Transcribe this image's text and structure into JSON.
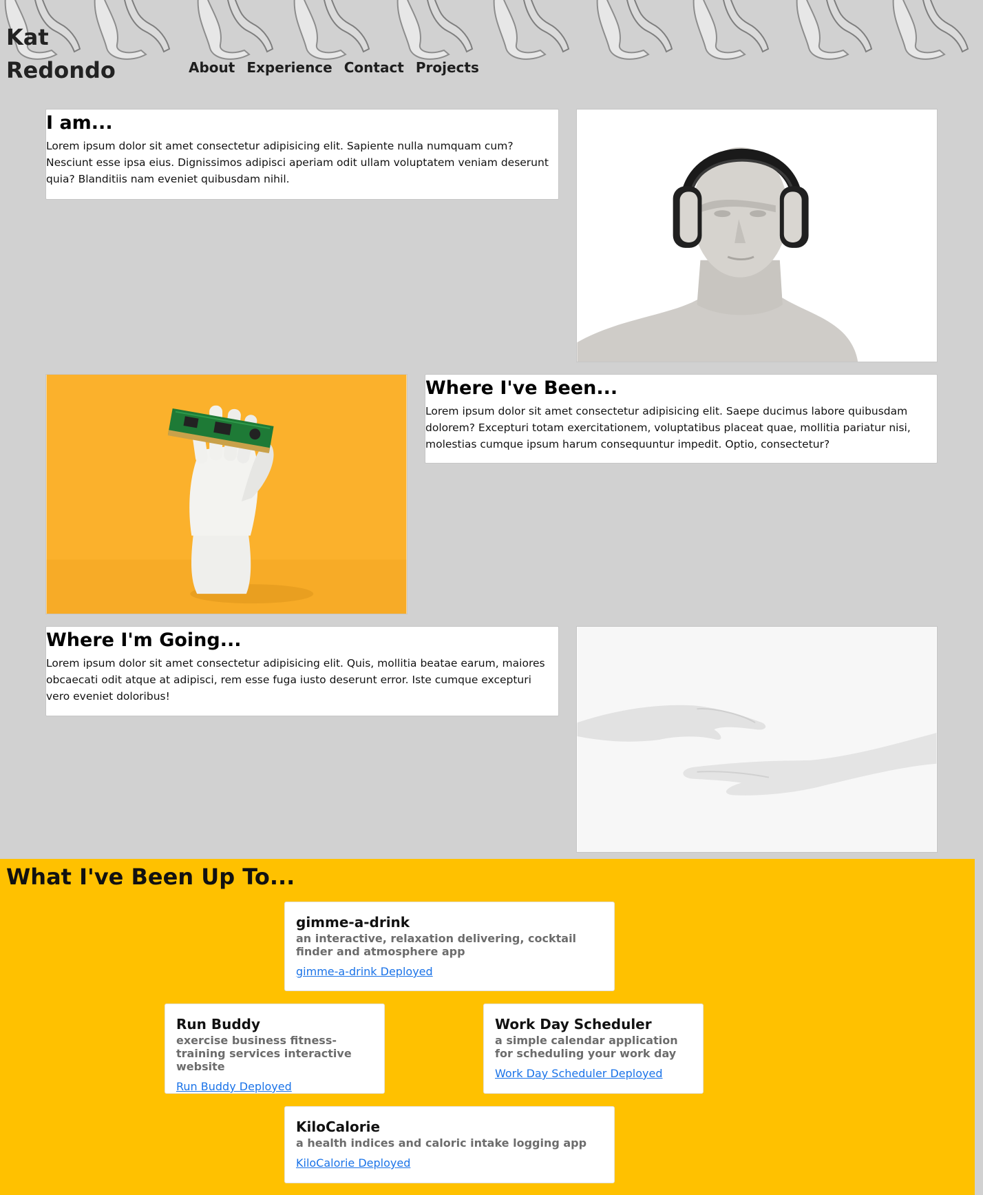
{
  "header": {
    "brand_line1": "Kat",
    "brand_line2": "Redondo",
    "nav": [
      "About",
      "Experience",
      "Contact",
      "Projects"
    ]
  },
  "sections": [
    {
      "title": "I am...",
      "body": "Lorem ipsum dolor sit amet consectetur adipisicing elit. Sapiente nulla numquam cum? Nesciunt esse ipsa eius. Dignissimos adipisci aperiam odit ullam voluptatem veniam deserunt quia? Blanditiis nam eveniet quibusdam nihil."
    },
    {
      "title": "Where I've Been...",
      "body": "Lorem ipsum dolor sit amet consectetur adipisicing elit. Saepe ducimus labore quibusdam dolorem? Excepturi totam exercitationem, voluptatibus placeat quae, mollitia pariatur nisi, molestias cumque ipsum harum consequuntur impedit. Optio, consectetur?"
    },
    {
      "title": "Where I'm Going...",
      "body": "Lorem ipsum dolor sit amet consectetur adipisicing elit. Quis, mollitia beatae earum, maiores obcaecati odit atque at adipisci, rem esse fuga iusto deserunt error. Iste cumque excepturi vero eveniet doloribus!"
    }
  ],
  "projects": {
    "title": "What I've Been Up To...",
    "items": [
      {
        "name": "gimme-a-drink",
        "description": "an interactive, relaxation delivering, cocktail finder and atmosphere app",
        "link": "gimme-a-drink Deployed"
      },
      {
        "name": "Run Buddy",
        "description": "exercise business fitness-training services interactive website",
        "link": "Run Buddy Deployed"
      },
      {
        "name": "Work Day Scheduler",
        "description": "a simple calendar application for scheduling your work day",
        "link": "Work Day Scheduler Deployed"
      },
      {
        "name": "KiloCalorie",
        "description": "a health indices and caloric intake logging app",
        "link": "KiloCalorie Deployed"
      }
    ]
  },
  "colors": {
    "page_background": "#d1d1d1",
    "projects_background": "#ffc100",
    "link": "#1a73e8",
    "photo_orange": "#fbb12c"
  },
  "images": {
    "header_banner": "mannequin-hands-pattern",
    "about_image": "mannequin-with-headphones",
    "experience_image": "mannequin-hand-holding-circuit-board",
    "future_image": "two-mannequin-hands-reaching"
  }
}
